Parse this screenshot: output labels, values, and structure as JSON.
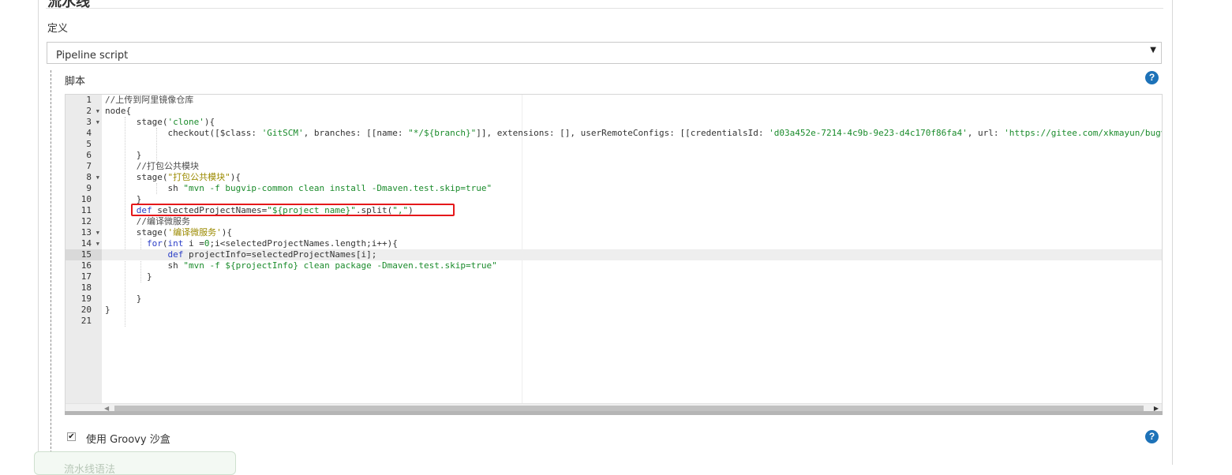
{
  "section_title": "流水线",
  "definition_label": "定义",
  "definition_select": {
    "value": "Pipeline script",
    "arrow": "▼"
  },
  "script_label": "脚本",
  "help_symbol": "?",
  "editor": {
    "active_line": 15,
    "lines": [
      {
        "n": "1",
        "fold": false,
        "tokens": [
          [
            "cmt",
            "//上传到阿里镜像仓库"
          ]
        ]
      },
      {
        "n": "2",
        "fold": true,
        "tokens": [
          [
            "",
            "node{"
          ]
        ]
      },
      {
        "n": "3",
        "fold": true,
        "tokens": [
          [
            "",
            "      stage("
          ],
          [
            "str",
            "'clone'"
          ],
          [
            "",
            "){"
          ]
        ]
      },
      {
        "n": "4",
        "fold": false,
        "tokens": [
          [
            "",
            "            checkout([$class: "
          ],
          [
            "str",
            "'GitSCM'"
          ],
          [
            "",
            ", branches: [[name: "
          ],
          [
            "str",
            "\"*/${branch}\""
          ],
          [
            "",
            "]], extensions: [], userRemoteConfigs: [[credentialsId: "
          ],
          [
            "str",
            "'d03a452e-7214-4c9b-9e23-d4c170f86fa4'"
          ],
          [
            "",
            ", url: "
          ],
          [
            "str",
            "'https://gitee.com/xkmayun/bugv"
          ]
        ]
      },
      {
        "n": "5",
        "fold": false,
        "tokens": [
          [
            "",
            ""
          ]
        ]
      },
      {
        "n": "6",
        "fold": false,
        "tokens": [
          [
            "",
            "      }"
          ]
        ]
      },
      {
        "n": "7",
        "fold": false,
        "tokens": [
          [
            "cmt",
            "      //打包公共模块"
          ]
        ]
      },
      {
        "n": "8",
        "fold": true,
        "tokens": [
          [
            "",
            "      stage("
          ],
          [
            "str2",
            "\"打包公共模块\""
          ],
          [
            "",
            "){"
          ]
        ]
      },
      {
        "n": "9",
        "fold": false,
        "tokens": [
          [
            "",
            "            sh "
          ],
          [
            "str",
            "\"mvn -f bugvip-common clean install -Dmaven.test.skip=true\""
          ]
        ]
      },
      {
        "n": "10",
        "fold": false,
        "tokens": [
          [
            "",
            "      }"
          ]
        ]
      },
      {
        "n": "11",
        "fold": false,
        "tokens": [
          [
            "kw",
            "      def"
          ],
          [
            "",
            " selectedProjectNames="
          ],
          [
            "str",
            "\"${project_name}\""
          ],
          [
            "",
            ".split("
          ],
          [
            "str",
            "\",\""
          ],
          [
            "",
            ")"
          ]
        ]
      },
      {
        "n": "12",
        "fold": false,
        "tokens": [
          [
            "cmt",
            "      //编译微服务"
          ]
        ]
      },
      {
        "n": "13",
        "fold": true,
        "tokens": [
          [
            "",
            "      stage("
          ],
          [
            "str2",
            "'编译微服务'"
          ],
          [
            "",
            "){"
          ]
        ]
      },
      {
        "n": "14",
        "fold": true,
        "tokens": [
          [
            "",
            "        "
          ],
          [
            "kw",
            "for"
          ],
          [
            "",
            "("
          ],
          [
            "kw",
            "int"
          ],
          [
            "",
            " i ="
          ],
          [
            "str",
            "0"
          ],
          [
            "",
            ";i<selectedProjectNames.length;i++){"
          ]
        ]
      },
      {
        "n": "15",
        "fold": false,
        "tokens": [
          [
            "",
            "            "
          ],
          [
            "kw",
            "def"
          ],
          [
            "",
            " projectInfo=selectedProjectNames[i];"
          ]
        ]
      },
      {
        "n": "16",
        "fold": false,
        "tokens": [
          [
            "",
            "            sh "
          ],
          [
            "str",
            "\"mvn -f ${projectInfo} clean package -Dmaven.test.skip=true\""
          ]
        ]
      },
      {
        "n": "17",
        "fold": false,
        "tokens": [
          [
            "",
            "        }"
          ]
        ]
      },
      {
        "n": "18",
        "fold": false,
        "tokens": [
          [
            "",
            ""
          ]
        ]
      },
      {
        "n": "19",
        "fold": false,
        "tokens": [
          [
            "",
            "      }"
          ]
        ]
      },
      {
        "n": "20",
        "fold": false,
        "tokens": [
          [
            "",
            "}"
          ]
        ]
      },
      {
        "n": "21",
        "fold": false,
        "tokens": [
          [
            "",
            ""
          ]
        ]
      }
    ]
  },
  "sandbox": {
    "checked": true,
    "check_mark": "✔",
    "label": "使用 Groovy 沙盒"
  },
  "pipeline_syntax_link": "流水线语法",
  "colors": {
    "highlight_box": "#e5181b",
    "help_icon": "#1d72b8",
    "keyword": "#2b3ec7",
    "string": "#1a8b2b"
  }
}
